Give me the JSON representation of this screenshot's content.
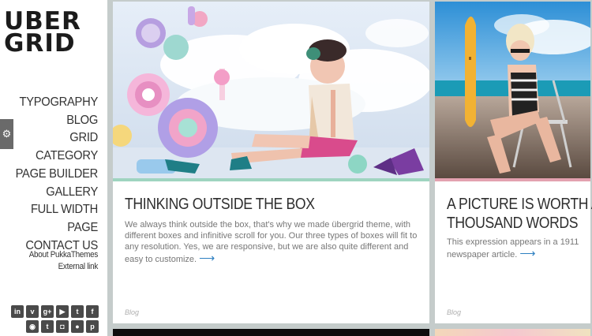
{
  "logo": {
    "line1": "UBER",
    "line2": "GRID"
  },
  "menu": [
    {
      "label": "TYPOGRAPHY"
    },
    {
      "label": "BLOG"
    },
    {
      "label": "GRID CATEGORY"
    },
    {
      "label": "PAGE BUILDER"
    },
    {
      "label": "GALLERY"
    },
    {
      "label": "FULL WIDTH PAGE"
    },
    {
      "label": "CONTACT US"
    }
  ],
  "side_tab": {
    "icon": "gear-icon",
    "glyph": "⚙"
  },
  "side_links": [
    {
      "label": "About PukkaThemes"
    },
    {
      "label": "External link"
    }
  ],
  "social": {
    "row1": [
      {
        "icon": "linkedin-icon",
        "glyph": "in"
      },
      {
        "icon": "vimeo-icon",
        "glyph": "v"
      },
      {
        "icon": "googleplus-icon",
        "glyph": "g+"
      },
      {
        "icon": "youtube-icon",
        "glyph": "▶"
      },
      {
        "icon": "twitter-icon",
        "glyph": "t"
      },
      {
        "icon": "facebook-icon",
        "glyph": "f"
      }
    ],
    "row2": [
      {
        "icon": "rss-icon",
        "glyph": "◉"
      },
      {
        "icon": "tumblr-icon",
        "glyph": "t"
      },
      {
        "icon": "instagram-icon",
        "glyph": "◘"
      },
      {
        "icon": "flickr-icon",
        "glyph": "●"
      },
      {
        "icon": "pinterest-icon",
        "glyph": "p"
      }
    ]
  },
  "posts": [
    {
      "title": "THINKING OUTSIDE THE BOX",
      "excerpt": "We always think outside the box, that's why we made übergrid theme, with different boxes and infinitive scroll for you. Our three types of boxes will fit to any resolution. Yes, we are responsive, but we are also quite different and easy to customize.",
      "arrow": "⟶",
      "category": "Blog",
      "accent": "#9fd4c0"
    },
    {
      "title_line1": "A PICTURE IS WORTH A",
      "title_line2": "THOUSAND WORDS",
      "excerpt": "This expression appears in a 1911 newspaper article.",
      "arrow": "⟶",
      "category": "Blog",
      "accent": "#e3a1b0"
    }
  ]
}
